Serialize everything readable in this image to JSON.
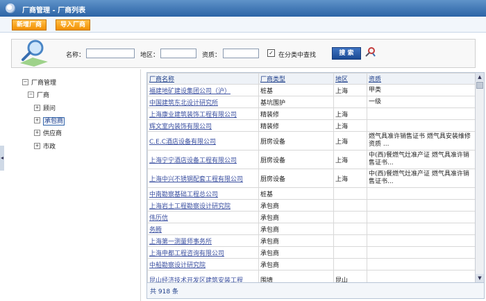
{
  "window": {
    "title": "厂商管理 - 厂商列表"
  },
  "toolbar": {
    "add_label": "新增厂商",
    "import_label": "导入厂商"
  },
  "search": {
    "name_label": "名称：",
    "name_value": "",
    "region_label": "地区：",
    "region_value": "",
    "qual_label": "资质：",
    "qual_value": "",
    "in_category_checked": true,
    "in_category_mark": "✓",
    "in_category_label": "在分类中查找",
    "search_button": "搜 索"
  },
  "tree": {
    "root": {
      "label": "厂商管理",
      "expander": "−"
    },
    "vendor": {
      "label": "厂商",
      "expander": "−"
    },
    "items": [
      {
        "label": "顾问",
        "expander": "+"
      },
      {
        "label": "承包商",
        "expander": "+"
      },
      {
        "label": "供应商",
        "expander": "+"
      },
      {
        "label": "市政",
        "expander": "+"
      }
    ],
    "selected_index": 1
  },
  "grid": {
    "columns": [
      "厂商名称",
      "厂商类型",
      "地区",
      "资质"
    ],
    "rows": [
      {
        "name": "福建地矿建设集团公司（沪）",
        "type": "桩基",
        "region": "上海",
        "qual": "甲类"
      },
      {
        "name": "中国建筑东北设计研究所",
        "type": "基坑围护",
        "region": "",
        "qual": "一级"
      },
      {
        "name": "上海康业建筑装饰工程有限公司",
        "type": "精装修",
        "region": "上海",
        "qual": ""
      },
      {
        "name": "辉文室内装饰有限公司",
        "type": "精装修",
        "region": "上海",
        "qual": ""
      },
      {
        "name": "C.E.C酒店设备有限公司",
        "type": "厨房设备",
        "region": "上海",
        "qual": "燃气具准许销售证书 燃气具安装维修资质 ..."
      },
      {
        "name": "上海宁宁酒店设备工程有限公司",
        "type": "厨房设备",
        "region": "上海",
        "qual": "中(西)餐燃气灶准产证 燃气具准许销售证书..."
      },
      {
        "name": "上海中兴不锈钢配套工程有限公司",
        "type": "厨房设备",
        "region": "上海",
        "qual": "中(西)餐燃气灶准产证 燃气具准许销售证书..."
      },
      {
        "name": "中南勘察基础工程总公司",
        "type": "桩基",
        "region": "",
        "qual": ""
      },
      {
        "name": "上海岩土工程勘察设计研究院",
        "type": "承包商",
        "region": "",
        "qual": ""
      },
      {
        "name": "伟历信",
        "type": "承包商",
        "region": "",
        "qual": ""
      },
      {
        "name": "务腾",
        "type": "承包商",
        "region": "",
        "qual": ""
      },
      {
        "name": "上海第一测量师事务所",
        "type": "承包商",
        "region": "",
        "qual": ""
      },
      {
        "name": "上海申都工程咨询有限公司",
        "type": "承包商",
        "region": "",
        "qual": ""
      },
      {
        "name": "中船勘察设计研究院",
        "type": "承包商",
        "region": "",
        "qual": ""
      },
      {
        "name": "昆山经济技术开发区建筑安装工程",
        "type": "围墙",
        "region": "昆山",
        "qual": ""
      }
    ],
    "scroll_up": "▲",
    "scroll_down": "▼"
  },
  "footer": {
    "total_text": "共 918 条"
  },
  "splitter": {
    "arrow": "◂"
  },
  "colors": {
    "title_bar": "#2c64a6",
    "button_orange": "#f29000",
    "search_blue": "#1b4a94",
    "link_blue": "#3a4fa0"
  },
  "icons": {
    "app": "app-logo-icon",
    "search_art": "magnifier-icon",
    "tools": "tools-icon"
  }
}
